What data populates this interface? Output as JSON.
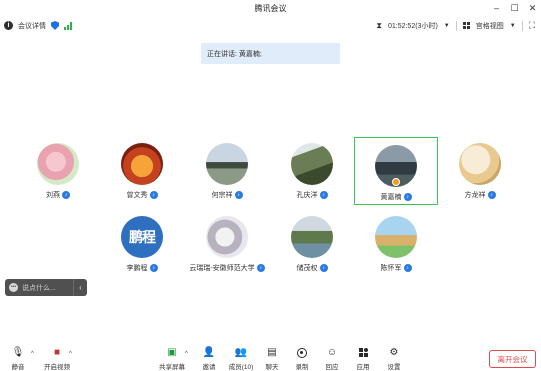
{
  "window": {
    "title": "腾讯会议",
    "controls": [
      "minimize-icon",
      "maximize-icon",
      "close-icon"
    ]
  },
  "infobar": {
    "meeting_details": "会议详情",
    "timer": "01:52:52(3小时)",
    "view_mode": "宫格视图"
  },
  "speaking_banner": "正在讲话: 黄嘉楠;",
  "participants": [
    {
      "name": "刘燕"
    },
    {
      "name": "曾文秀"
    },
    {
      "name": "何宗祥"
    },
    {
      "name": "孔庆洋"
    },
    {
      "name": "黄嘉楠",
      "active": true
    },
    {
      "name": "方龙祥"
    },
    {
      "name": "李鹏程",
      "avatar_text": "鹏程"
    },
    {
      "name": "云瑞瑞-安徽师范大学"
    },
    {
      "name": "储茂权"
    },
    {
      "name": "陈怀军"
    }
  ],
  "chat": {
    "placeholder": "说点什么..."
  },
  "toolbar": {
    "mute": "静音",
    "video": "开启视频",
    "share": "共享屏幕",
    "invite": "邀请",
    "members": "成员(10)",
    "chat": "聊天",
    "record": "录制",
    "replay": "回应",
    "apps": "应用",
    "settings": "设置",
    "leave": "离开会议"
  },
  "colors": {
    "accent_blue": "#2a7ae2",
    "active_border": "#3fc45a",
    "leave_red": "#e04b4b",
    "banner_bg": "#e0ecf9"
  }
}
